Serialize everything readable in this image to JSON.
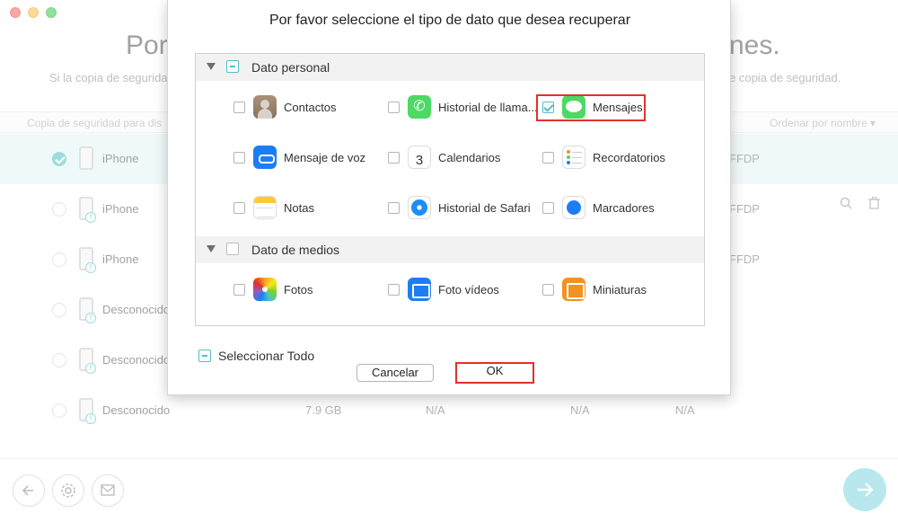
{
  "background": {
    "title_left": "Por",
    "title_right": "nes.",
    "subtitle_left": "Si la copia de segurida",
    "subtitle_right": "e copia de seguridad.",
    "column_left": "Copia de seguridad para dis",
    "sort_label": "Ordenar por nombre ▾",
    "rows": [
      {
        "name": "iPhone",
        "id": "FFDP",
        "size": "",
        "c1": "",
        "c2": "",
        "c3": ""
      },
      {
        "name": "iPhone",
        "id": "FFDP",
        "size": "",
        "c1": "",
        "c2": "",
        "c3": ""
      },
      {
        "name": "iPhone",
        "id": "FFDP",
        "size": "",
        "c1": "",
        "c2": "",
        "c3": ""
      },
      {
        "name": "Desconocido",
        "id": "",
        "size": "",
        "c1": "",
        "c2": "",
        "c3": ""
      },
      {
        "name": "Desconocido",
        "id": "",
        "size": "",
        "c1": "",
        "c2": "",
        "c3": ""
      },
      {
        "name": "Desconocido",
        "id": "",
        "size": "7.9 GB",
        "c1": "N/A",
        "c2": "N/A",
        "c3": "N/A"
      }
    ]
  },
  "dialog": {
    "title": "Por favor seleccione el tipo de dato que desea recuperar",
    "sections": [
      {
        "label": "Dato personal",
        "items": [
          {
            "label": "Contactos",
            "icon": "contacts-icon",
            "checked": false
          },
          {
            "label": "Historial de llama...",
            "icon": "phone-icon",
            "checked": false
          },
          {
            "label": "Mensajes",
            "icon": "messages-icon",
            "checked": true
          },
          {
            "label": "Mensaje de voz",
            "icon": "voicemail-icon",
            "checked": false
          },
          {
            "label": "Calendarios",
            "icon": "calendar-icon",
            "checked": false
          },
          {
            "label": "Recordatorios",
            "icon": "reminders-icon",
            "checked": false
          },
          {
            "label": "Notas",
            "icon": "notes-icon",
            "checked": false
          },
          {
            "label": "Historial de Safari",
            "icon": "safari-icon",
            "checked": false
          },
          {
            "label": "Marcadores",
            "icon": "bookmarks-icon",
            "checked": false
          }
        ]
      },
      {
        "label": "Dato de medios",
        "items": [
          {
            "label": "Fotos",
            "icon": "photos-icon",
            "checked": false
          },
          {
            "label": "Foto vídeos",
            "icon": "photo-videos-icon",
            "checked": false
          },
          {
            "label": "Miniaturas",
            "icon": "thumbnails-icon",
            "checked": false
          }
        ]
      }
    ],
    "calendar_day": "3",
    "select_all": "Seleccionar Todo",
    "cancel_label": "Cancelar",
    "ok_label": "OK"
  },
  "colors": {
    "accent": "#4cc2c6",
    "highlight": "#e0322a"
  }
}
